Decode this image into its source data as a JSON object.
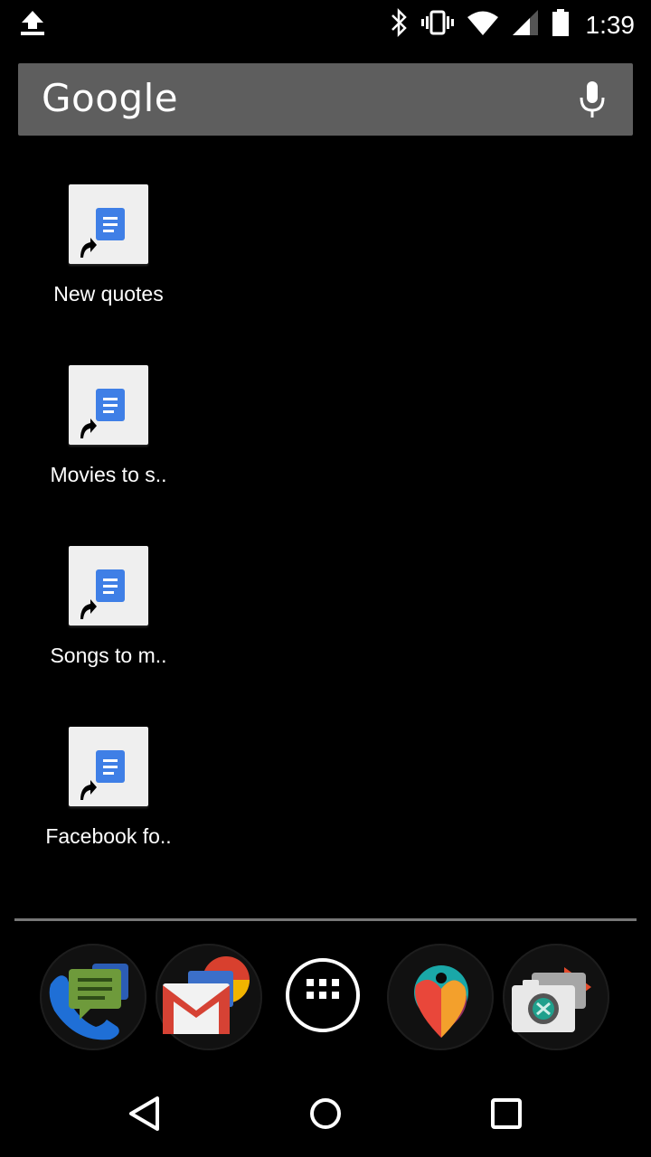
{
  "status_bar": {
    "time": "1:39",
    "icons": [
      "upload-icon",
      "bluetooth-icon",
      "vibrate-icon",
      "wifi-icon",
      "signal-icon",
      "battery-icon"
    ]
  },
  "search": {
    "logo_text": "Google",
    "icon": "mic-icon"
  },
  "shortcuts": [
    {
      "label": "New quotes",
      "icon": "google-docs-shortcut-icon"
    },
    {
      "label": "Movies to s..",
      "icon": "google-docs-shortcut-icon"
    },
    {
      "label": "Songs to m..",
      "icon": "google-docs-shortcut-icon"
    },
    {
      "label": "Facebook fo..",
      "icon": "google-docs-shortcut-icon"
    }
  ],
  "dock": [
    {
      "name": "phone-messages-folder",
      "icon": "phone-messages-folder-icon"
    },
    {
      "name": "gmail-folder",
      "icon": "gmail-folder-icon"
    },
    {
      "name": "app-drawer",
      "icon": "app-drawer-icon"
    },
    {
      "name": "fit-folder",
      "icon": "google-fit-folder-icon"
    },
    {
      "name": "camera-folder",
      "icon": "camera-folder-icon"
    }
  ],
  "nav": {
    "back": "back-icon",
    "home": "home-icon",
    "recents": "recents-icon"
  },
  "colors": {
    "background": "#000000",
    "search_bg": "#5e5e5e",
    "docs_blue": "#3f7fe6",
    "divider": "#777777"
  }
}
